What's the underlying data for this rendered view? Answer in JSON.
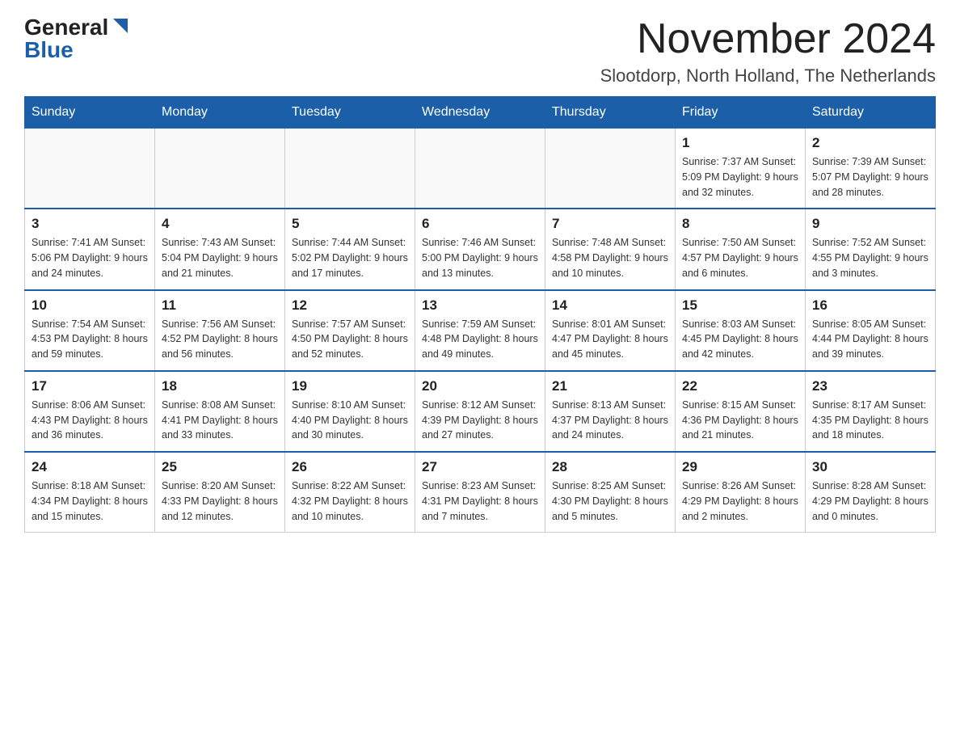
{
  "logo": {
    "general": "General",
    "blue": "Blue"
  },
  "title": "November 2024",
  "subtitle": "Slootdorp, North Holland, The Netherlands",
  "days_of_week": [
    "Sunday",
    "Monday",
    "Tuesday",
    "Wednesday",
    "Thursday",
    "Friday",
    "Saturday"
  ],
  "weeks": [
    [
      {
        "day": "",
        "info": ""
      },
      {
        "day": "",
        "info": ""
      },
      {
        "day": "",
        "info": ""
      },
      {
        "day": "",
        "info": ""
      },
      {
        "day": "",
        "info": ""
      },
      {
        "day": "1",
        "info": "Sunrise: 7:37 AM\nSunset: 5:09 PM\nDaylight: 9 hours and 32 minutes."
      },
      {
        "day": "2",
        "info": "Sunrise: 7:39 AM\nSunset: 5:07 PM\nDaylight: 9 hours and 28 minutes."
      }
    ],
    [
      {
        "day": "3",
        "info": "Sunrise: 7:41 AM\nSunset: 5:06 PM\nDaylight: 9 hours and 24 minutes."
      },
      {
        "day": "4",
        "info": "Sunrise: 7:43 AM\nSunset: 5:04 PM\nDaylight: 9 hours and 21 minutes."
      },
      {
        "day": "5",
        "info": "Sunrise: 7:44 AM\nSunset: 5:02 PM\nDaylight: 9 hours and 17 minutes."
      },
      {
        "day": "6",
        "info": "Sunrise: 7:46 AM\nSunset: 5:00 PM\nDaylight: 9 hours and 13 minutes."
      },
      {
        "day": "7",
        "info": "Sunrise: 7:48 AM\nSunset: 4:58 PM\nDaylight: 9 hours and 10 minutes."
      },
      {
        "day": "8",
        "info": "Sunrise: 7:50 AM\nSunset: 4:57 PM\nDaylight: 9 hours and 6 minutes."
      },
      {
        "day": "9",
        "info": "Sunrise: 7:52 AM\nSunset: 4:55 PM\nDaylight: 9 hours and 3 minutes."
      }
    ],
    [
      {
        "day": "10",
        "info": "Sunrise: 7:54 AM\nSunset: 4:53 PM\nDaylight: 8 hours and 59 minutes."
      },
      {
        "day": "11",
        "info": "Sunrise: 7:56 AM\nSunset: 4:52 PM\nDaylight: 8 hours and 56 minutes."
      },
      {
        "day": "12",
        "info": "Sunrise: 7:57 AM\nSunset: 4:50 PM\nDaylight: 8 hours and 52 minutes."
      },
      {
        "day": "13",
        "info": "Sunrise: 7:59 AM\nSunset: 4:48 PM\nDaylight: 8 hours and 49 minutes."
      },
      {
        "day": "14",
        "info": "Sunrise: 8:01 AM\nSunset: 4:47 PM\nDaylight: 8 hours and 45 minutes."
      },
      {
        "day": "15",
        "info": "Sunrise: 8:03 AM\nSunset: 4:45 PM\nDaylight: 8 hours and 42 minutes."
      },
      {
        "day": "16",
        "info": "Sunrise: 8:05 AM\nSunset: 4:44 PM\nDaylight: 8 hours and 39 minutes."
      }
    ],
    [
      {
        "day": "17",
        "info": "Sunrise: 8:06 AM\nSunset: 4:43 PM\nDaylight: 8 hours and 36 minutes."
      },
      {
        "day": "18",
        "info": "Sunrise: 8:08 AM\nSunset: 4:41 PM\nDaylight: 8 hours and 33 minutes."
      },
      {
        "day": "19",
        "info": "Sunrise: 8:10 AM\nSunset: 4:40 PM\nDaylight: 8 hours and 30 minutes."
      },
      {
        "day": "20",
        "info": "Sunrise: 8:12 AM\nSunset: 4:39 PM\nDaylight: 8 hours and 27 minutes."
      },
      {
        "day": "21",
        "info": "Sunrise: 8:13 AM\nSunset: 4:37 PM\nDaylight: 8 hours and 24 minutes."
      },
      {
        "day": "22",
        "info": "Sunrise: 8:15 AM\nSunset: 4:36 PM\nDaylight: 8 hours and 21 minutes."
      },
      {
        "day": "23",
        "info": "Sunrise: 8:17 AM\nSunset: 4:35 PM\nDaylight: 8 hours and 18 minutes."
      }
    ],
    [
      {
        "day": "24",
        "info": "Sunrise: 8:18 AM\nSunset: 4:34 PM\nDaylight: 8 hours and 15 minutes."
      },
      {
        "day": "25",
        "info": "Sunrise: 8:20 AM\nSunset: 4:33 PM\nDaylight: 8 hours and 12 minutes."
      },
      {
        "day": "26",
        "info": "Sunrise: 8:22 AM\nSunset: 4:32 PM\nDaylight: 8 hours and 10 minutes."
      },
      {
        "day": "27",
        "info": "Sunrise: 8:23 AM\nSunset: 4:31 PM\nDaylight: 8 hours and 7 minutes."
      },
      {
        "day": "28",
        "info": "Sunrise: 8:25 AM\nSunset: 4:30 PM\nDaylight: 8 hours and 5 minutes."
      },
      {
        "day": "29",
        "info": "Sunrise: 8:26 AM\nSunset: 4:29 PM\nDaylight: 8 hours and 2 minutes."
      },
      {
        "day": "30",
        "info": "Sunrise: 8:28 AM\nSunset: 4:29 PM\nDaylight: 8 hours and 0 minutes."
      }
    ]
  ]
}
